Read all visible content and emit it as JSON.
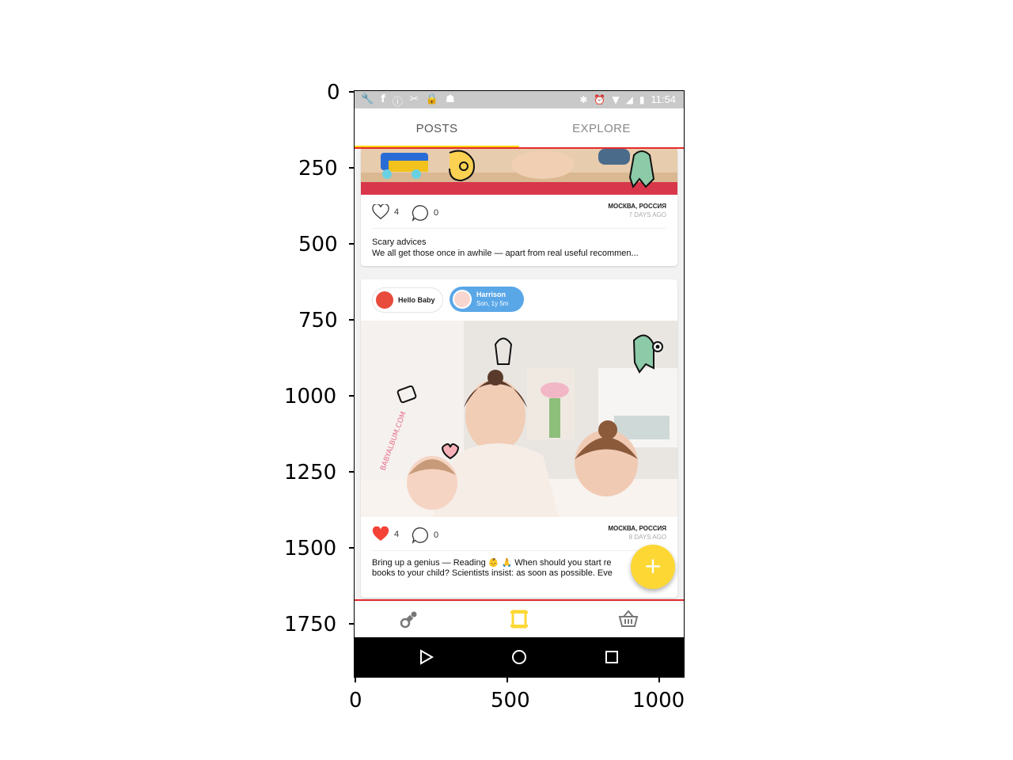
{
  "plot_axes": {
    "y_ticks": [
      "0",
      "250",
      "500",
      "750",
      "1000",
      "1250",
      "1500",
      "1750"
    ],
    "x_ticks": [
      "0",
      "500",
      "1000"
    ]
  },
  "status_bar": {
    "time": "11:54"
  },
  "tabs": {
    "posts": "POSTS",
    "explore": "EXPLORE",
    "active": "POSTS"
  },
  "post1": {
    "likes": "4",
    "comments": "0",
    "location": "МОСКВА, РОССИЯ",
    "time_ago": "7 DAYS AGO",
    "title": "Scary advices",
    "body": "We all get those once in awhile — apart from real useful recommen..."
  },
  "post2": {
    "chips": [
      {
        "name": "Hello Baby",
        "subtitle": ""
      },
      {
        "name": "Harrison",
        "subtitle": "Son, 1y 5m"
      }
    ],
    "image_watermark": "BABYALBUM.COM",
    "likes": "4",
    "comments": "0",
    "location": "МОСКВА, РОССИЯ",
    "time_ago": "8 DAYS AGO",
    "text_line1": "Bring up a genius — Reading 👶 🙏 When should you start re",
    "text_line2": "books to your child? Scientists insist: as soon as possible. Eve"
  },
  "fab": {
    "label": "+"
  },
  "bottom_nav": [
    "pacifier-icon",
    "film-icon",
    "basket-icon"
  ],
  "colors": {
    "accent": "#ffd600",
    "like": "#f44336",
    "chip_blue": "#5aa7e8",
    "highlight_red": "#e52b2b"
  }
}
